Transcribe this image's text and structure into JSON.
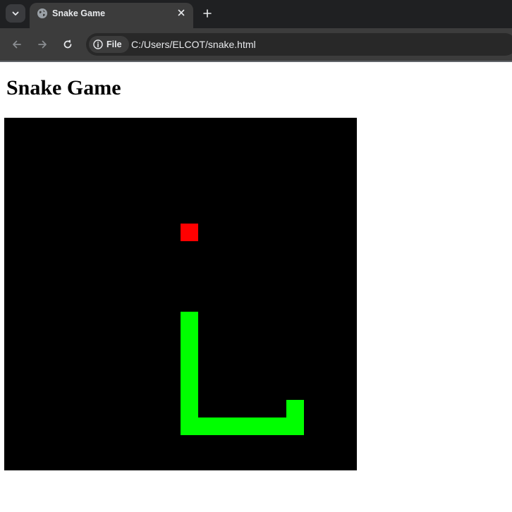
{
  "browser": {
    "tab": {
      "title": "Snake Game",
      "favicon": "globe-icon",
      "close_icon": "close-icon"
    },
    "tab_menu_icon": "chevron-down-icon",
    "new_tab_icon": "plus-icon",
    "nav": {
      "back_icon": "arrow-left-icon",
      "forward_icon": "arrow-right-icon",
      "reload_icon": "reload-icon"
    },
    "address_bar": {
      "site_info_label": "File",
      "site_info_icon": "info-icon",
      "url": "C:/Users/ELCOT/snake.html"
    }
  },
  "page": {
    "heading": "Snake Game",
    "game": {
      "grid_cells": 20,
      "background_color": "#000000",
      "snake_color": "#00ff00",
      "food_color": "#ff0000",
      "food": {
        "col": 10,
        "row": 6
      },
      "snake": [
        {
          "col": 16,
          "row": 16
        },
        {
          "col": 16,
          "row": 17
        },
        {
          "col": 15,
          "row": 17
        },
        {
          "col": 14,
          "row": 17
        },
        {
          "col": 13,
          "row": 17
        },
        {
          "col": 12,
          "row": 17
        },
        {
          "col": 11,
          "row": 17
        },
        {
          "col": 10,
          "row": 17
        },
        {
          "col": 10,
          "row": 16
        },
        {
          "col": 10,
          "row": 15
        },
        {
          "col": 10,
          "row": 14
        },
        {
          "col": 10,
          "row": 13
        },
        {
          "col": 10,
          "row": 12
        },
        {
          "col": 10,
          "row": 11
        }
      ]
    }
  }
}
